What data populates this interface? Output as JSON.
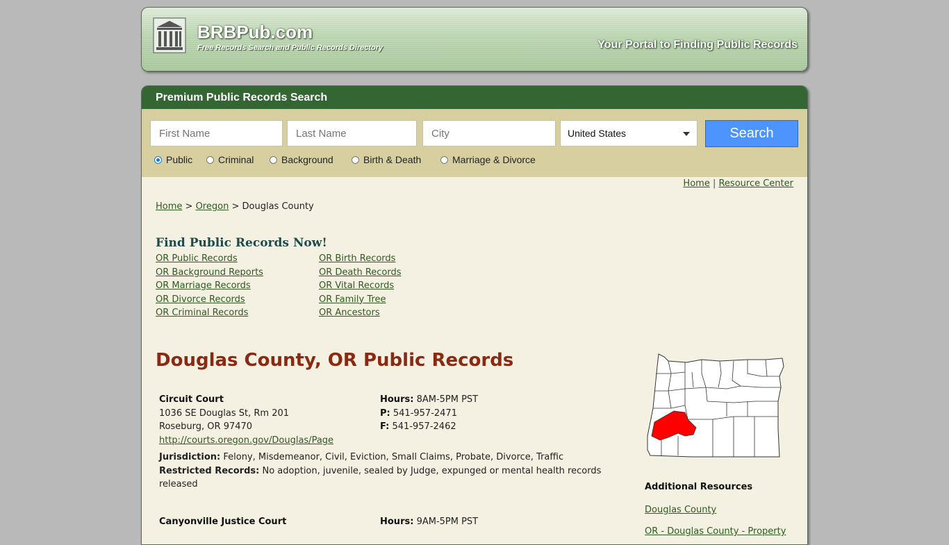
{
  "header": {
    "brand": "BRBPub.com",
    "tagline": "Free Records Search and Public Records Directory",
    "portal": "Your Portal to Finding Public Records"
  },
  "search": {
    "panel_title": "Premium Public Records Search",
    "first_name_placeholder": "First Name",
    "last_name_placeholder": "Last Name",
    "city_placeholder": "City",
    "country_selected": "United States",
    "button_label": "Search",
    "radios": [
      {
        "label": "Public",
        "checked": true
      },
      {
        "label": "Criminal",
        "checked": false
      },
      {
        "label": "Background",
        "checked": false
      },
      {
        "label": "Birth & Death",
        "checked": false
      },
      {
        "label": "Marriage & Divorce",
        "checked": false
      }
    ]
  },
  "top_links": {
    "home": "Home",
    "separator": "|",
    "resource_center": "Resource Center"
  },
  "breadcrumb": {
    "home": "Home",
    "sep1": ">",
    "state": "Oregon",
    "sep2": ">",
    "current": "Douglas County"
  },
  "find": {
    "title": "Find Public Records Now!",
    "left": [
      "OR Public Records",
      "OR Background Reports",
      "OR Marriage Records",
      "OR Divorce Records",
      "OR Criminal Records"
    ],
    "right": [
      "OR Birth Records",
      "OR Death Records",
      "OR Vital Records",
      "OR Family Tree",
      "OR Ancestors"
    ]
  },
  "county_title": "Douglas County, OR Public Records",
  "offices": [
    {
      "name": "Circuit Court",
      "address1": "1036 SE Douglas St, Rm 201",
      "address2": "Roseburg, OR 97470",
      "url": "http://courts.oregon.gov/Douglas/Page",
      "hours_label": "Hours:",
      "hours": "8AM-5PM PST",
      "phone_label": "P:",
      "phone": "541-957-2471",
      "fax_label": "F:",
      "fax": "541-957-2462",
      "jurisdiction_label": "Jurisdiction:",
      "jurisdiction": "Felony, Misdemeanor, Civil, Eviction, Small Claims, Probate, Divorce, Traffic",
      "restricted_label": "Restricted Records:",
      "restricted": "No adoption, juvenile, sealed by Judge, expunged or mental health records released"
    },
    {
      "name": "Canyonville Justice Court",
      "hours_label": "Hours:",
      "hours": "9AM-5PM PST"
    }
  ],
  "sidebar": {
    "additional_title": "Additional Resources",
    "link1": "Douglas County",
    "link2": "OR - Douglas County - Property"
  },
  "colors": {
    "panel_header": "#336633",
    "search_bg": "#d8cfa0",
    "content_bg": "#f4f0e2",
    "county_title": "#8b2a13",
    "search_button": "#4d94ff",
    "highlight_county": "#ff0000"
  }
}
